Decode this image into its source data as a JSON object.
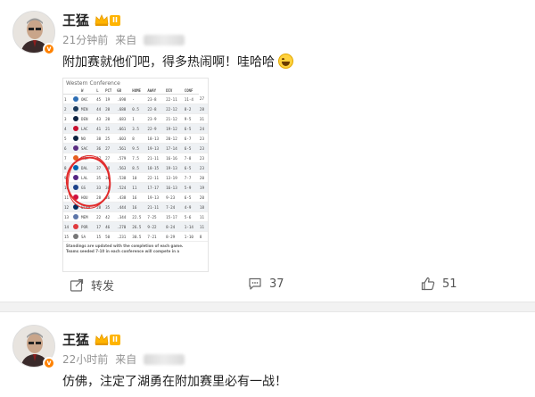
{
  "posts": [
    {
      "author": "王猛",
      "vip_level": "II",
      "time": "21分钟前",
      "source_prefix": "来自",
      "text": "附加赛就他们吧，得多热闹啊！哇哈哈",
      "emoji_icon": "laugh-tears-icon",
      "image": {
        "title": "Western Conference",
        "columns": [
          "",
          "",
          "W",
          "L",
          "PCT",
          "GB",
          "HOME",
          "AWAY",
          "DIV",
          "CONF"
        ],
        "rows": [
          {
            "rank": "1",
            "team": "OKC",
            "w": "45",
            "l": "19",
            "pct": ".698",
            "gb": "-",
            "home": "23-8",
            "away": "22-11",
            "div": "11-4",
            "conf": "27"
          },
          {
            "rank": "2",
            "team": "MIN",
            "w": "44",
            "l": "20",
            "pct": ".688",
            "gb": "0.5",
            "home": "22-8",
            "away": "22-12",
            "div": "8-2",
            "conf": "28"
          },
          {
            "rank": "3",
            "team": "DEN",
            "w": "43",
            "l": "20",
            "pct": ".683",
            "gb": "1",
            "home": "23-9",
            "away": "21-12",
            "div": "9-5",
            "conf": "31"
          },
          {
            "rank": "4",
            "team": "LAC",
            "w": "41",
            "l": "21",
            "pct": ".661",
            "gb": "3.5",
            "home": "22-9",
            "away": "19-12",
            "div": "6-5",
            "conf": "24"
          },
          {
            "rank": "5",
            "team": "NO",
            "w": "38",
            "l": "25",
            "pct": ".603",
            "gb": "8",
            "home": "18-13",
            "away": "20-12",
            "div": "6-7",
            "conf": "23"
          },
          {
            "rank": "6",
            "team": "SAC",
            "w": "36",
            "l": "27",
            "pct": ".561",
            "gb": "9.5",
            "home": "19-13",
            "away": "17-14",
            "div": "6-5",
            "conf": "23"
          },
          {
            "rank": "7",
            "team": "PHX",
            "w": "37",
            "l": "27",
            "pct": ".579",
            "gb": "7.5",
            "home": "21-11",
            "away": "16-16",
            "div": "7-8",
            "conf": "23"
          },
          {
            "rank": "8",
            "team": "DAL",
            "w": "37",
            "l": "28",
            "pct": ".563",
            "gb": "8.5",
            "home": "18-15",
            "away": "19-13",
            "div": "6-5",
            "conf": "23"
          },
          {
            "rank": "9",
            "team": "LAL",
            "w": "35",
            "l": "30",
            "pct": ".538",
            "gb": "10",
            "home": "22-11",
            "away": "13-19",
            "div": "7-7",
            "conf": "20"
          },
          {
            "rank": "10",
            "team": "GS",
            "w": "33",
            "l": "30",
            "pct": ".524",
            "gb": "11",
            "home": "17-17",
            "away": "16-13",
            "div": "5-9",
            "conf": "19"
          },
          {
            "rank": "11",
            "team": "HOU",
            "w": "28",
            "l": "36",
            "pct": ".438",
            "gb": "16",
            "home": "19-13",
            "away": "9-23",
            "div": "6-5",
            "conf": "20"
          },
          {
            "rank": "12",
            "team": "UTAH",
            "w": "28",
            "l": "35",
            "pct": ".444",
            "gb": "16",
            "home": "21-11",
            "away": "7-24",
            "div": "4-9",
            "conf": "18"
          },
          {
            "rank": "13",
            "team": "MEM",
            "w": "22",
            "l": "42",
            "pct": ".344",
            "gb": "22.5",
            "home": "7-25",
            "away": "15-17",
            "div": "5-6",
            "conf": "11"
          },
          {
            "rank": "14",
            "team": "POR",
            "w": "17",
            "l": "46",
            "pct": ".270",
            "gb": "26.5",
            "home": "9-22",
            "away": "8-24",
            "div": "1-14",
            "conf": "11"
          },
          {
            "rank": "15",
            "team": "SA",
            "w": "15",
            "l": "50",
            "pct": ".231",
            "gb": "30.5",
            "home": "7-21",
            "away": "8-29",
            "div": "1-10",
            "conf": "8"
          }
        ],
        "note1": "Standings are updated with the completion of each game.",
        "note2": "Teams seeded 7-10 in each conference will compete in a"
      },
      "actions": {
        "repost_label": "转发",
        "comment_count": "37",
        "like_count": "51"
      }
    },
    {
      "author": "王猛",
      "vip_level": "II",
      "time": "22小时前",
      "source_prefix": "来自",
      "text": "仿佛，注定了湖勇在附加赛里必有一战！"
    }
  ],
  "colors": {
    "accent_orange": "#ff8200",
    "annotation_red": "#e12b2b",
    "vip_gold": "#ffb400"
  }
}
